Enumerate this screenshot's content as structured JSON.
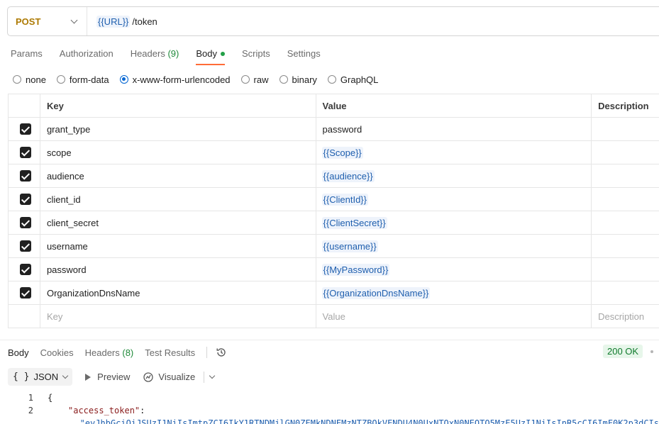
{
  "request": {
    "method": "POST",
    "url_variable": "{{URL}}",
    "url_path": "/token"
  },
  "request_tabs": [
    {
      "label": "Params"
    },
    {
      "label": "Authorization"
    },
    {
      "label": "Headers",
      "count": "(9)"
    },
    {
      "label": "Body",
      "active": true
    },
    {
      "label": "Scripts"
    },
    {
      "label": "Settings"
    }
  ],
  "body_types": [
    {
      "label": "none"
    },
    {
      "label": "form-data"
    },
    {
      "label": "x-www-form-urlencoded",
      "selected": true
    },
    {
      "label": "raw"
    },
    {
      "label": "binary"
    },
    {
      "label": "GraphQL"
    }
  ],
  "table": {
    "headers": {
      "key": "Key",
      "value": "Value",
      "description": "Description"
    },
    "rows": [
      {
        "checked": true,
        "key": "grant_type",
        "value": "password",
        "is_variable": false
      },
      {
        "checked": true,
        "key": "scope",
        "value": "{{Scope}}",
        "is_variable": true
      },
      {
        "checked": true,
        "key": "audience",
        "value": "{{audience}}",
        "is_variable": true
      },
      {
        "checked": true,
        "key": "client_id",
        "value": "{{ClientId}}",
        "is_variable": true
      },
      {
        "checked": true,
        "key": "client_secret",
        "value": "{{ClientSecret}}",
        "is_variable": true
      },
      {
        "checked": true,
        "key": "username",
        "value": "{{username}}",
        "is_variable": true
      },
      {
        "checked": true,
        "key": "password",
        "value": "{{MyPassword}}",
        "is_variable": true
      },
      {
        "checked": true,
        "key": "OrganizationDnsName",
        "value": "{{OrganizationDnsName}}",
        "is_variable": true
      }
    ],
    "placeholder": {
      "key": "Key",
      "value": "Value",
      "description": "Description"
    }
  },
  "response": {
    "tabs": [
      {
        "label": "Body",
        "active": true
      },
      {
        "label": "Cookies"
      },
      {
        "label": "Headers",
        "count": "(8)"
      },
      {
        "label": "Test Results"
      }
    ],
    "history_icon": "history-icon",
    "status": "200 OK",
    "format": "JSON",
    "preview_label": "Preview",
    "visualize_label": "Visualize",
    "code_lines": [
      {
        "num": "1",
        "text": "{"
      },
      {
        "num": "2",
        "key": "\"access_token\"",
        "sep": ":"
      },
      {
        "num": "",
        "str": "\"eyJhbGciOiJSUzI1NiIsImtpZCI6IkY1RTNDMjlGN0ZEMkNDNEMzNTZBOkVENDU4N0UxNTQxN0NEOTQ5MzE5UzI1NiIsInR5cCI6ImF0K2p3dCIs"
      }
    ]
  }
}
